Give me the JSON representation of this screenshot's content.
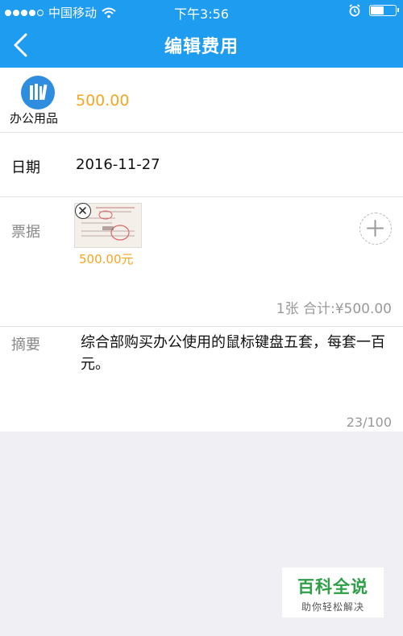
{
  "status_bar": {
    "carrier": "中国移动",
    "time": "下午3:56",
    "battery_level": 0.55
  },
  "header": {
    "title": "编辑费用",
    "background_color": "#1e9cf0"
  },
  "expense": {
    "category_label": "办公用品",
    "category_icon": "office-supplies-icon",
    "amount": "500.00",
    "amount_color": "#f5a623"
  },
  "date": {
    "label": "日期",
    "value": "2016-11-27"
  },
  "receipts": {
    "label": "票据",
    "items": [
      {
        "amount": "500.00元"
      }
    ],
    "summary": "1张 合计:¥500.00"
  },
  "memo": {
    "label": "摘要",
    "text": "综合部购买办公使用的鼠标键盘五套，每套一百元。",
    "counter": "23/100"
  },
  "watermark": {
    "title": "百科全说",
    "subtitle": "助你轻松解决"
  }
}
